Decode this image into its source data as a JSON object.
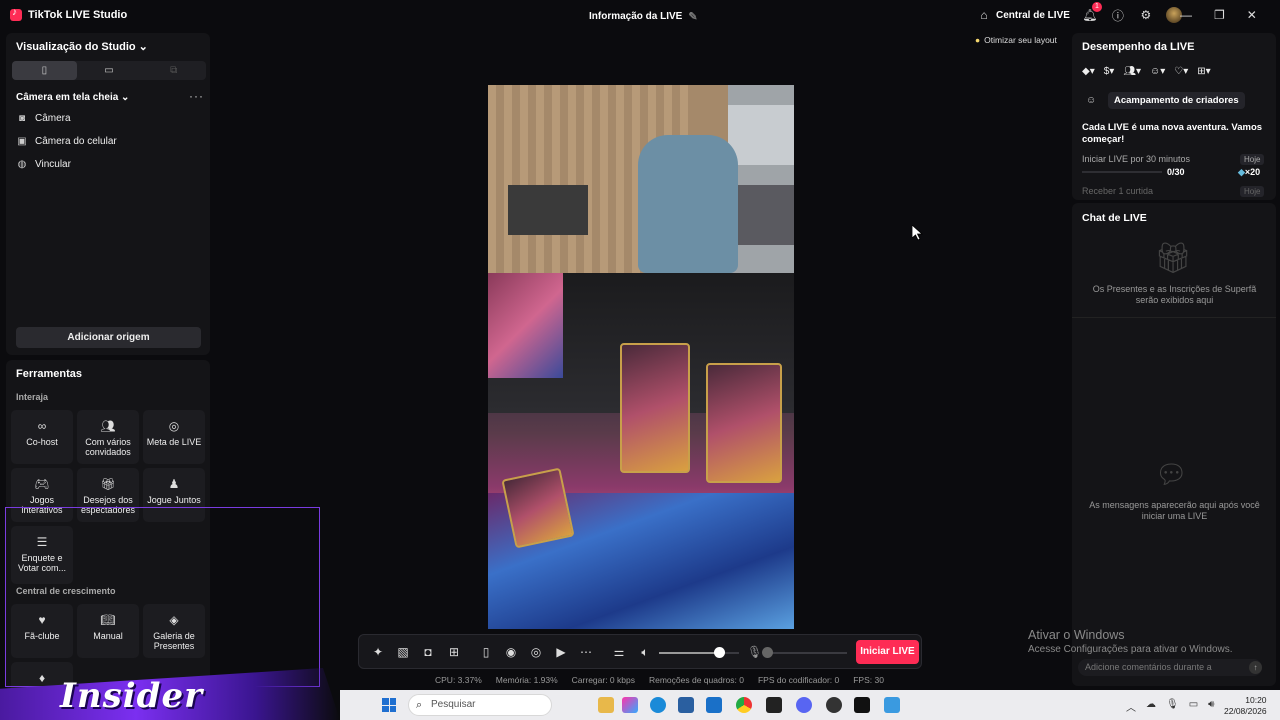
{
  "app": {
    "title": "TikTok LIVE Studio",
    "center_title": "Informação da LIVE",
    "live_hub": "Central de LIVE",
    "notification_count": "1",
    "layout_tip": "Otimizar seu layout"
  },
  "studio": {
    "title": "Visualização do Studio",
    "scene": "Câmera em tela cheia",
    "sources": [
      "Câmera",
      "Câmera do celular",
      "Vincular"
    ],
    "add_source": "Adicionar origem"
  },
  "tools": {
    "title": "Ferramentas",
    "interact_label": "Interaja",
    "interact": [
      "Co-host",
      "Com vários convidados",
      "Meta de LIVE",
      "Jogos interativos",
      "Desejos dos espectadores",
      "Jogue Juntos",
      "Enquete e Votar com..."
    ],
    "growth_label": "Central de crescimento",
    "growth": [
      "Fã-clube",
      "Manual",
      "Galeria de Presentes"
    ]
  },
  "performance": {
    "title": "Desempenho da LIVE",
    "camp_button": "Acampamento de criadores",
    "adventure": "Cada LIVE é uma nova aventura. Vamos começar!",
    "task1": "Iniciar LIVE por 30 minutos",
    "task1_badge": "Hoje",
    "task1_progress": "0/30",
    "task1_progress_value": 0,
    "task1_reward": "×20",
    "task2": "Receber 1 curtida",
    "task2_badge": "Hoje"
  },
  "chat": {
    "title": "Chat de LIVE",
    "gifts_msg": "Os Presentes e as Inscrições de Superfã serão exibidos aqui",
    "messages_msg": "As mensagens aparecerão aqui após você iniciar uma LIVE",
    "input_placeholder": "Adicione comentários durante a"
  },
  "toolbar": {
    "start_live": "Iniciar LIVE",
    "volume_level": 0.75,
    "mic_level": 0.0
  },
  "stats": {
    "cpu": "CPU: 3.37%",
    "memory": "Memória: 1.93%",
    "upload": "Carregar: 0 kbps",
    "dropped": "Remoções de quadros: 0",
    "encoder_fps": "FPS do codificador: 0",
    "fps": "FPS: 30"
  },
  "watermark": {
    "line1": "Ativar o Windows",
    "line2": "Acesse Configurações para ativar o Windows."
  },
  "overlay": {
    "logo": "Insider"
  },
  "taskbar": {
    "search": "Pesquisar",
    "time": "10:20",
    "date": "22/08/2026"
  }
}
